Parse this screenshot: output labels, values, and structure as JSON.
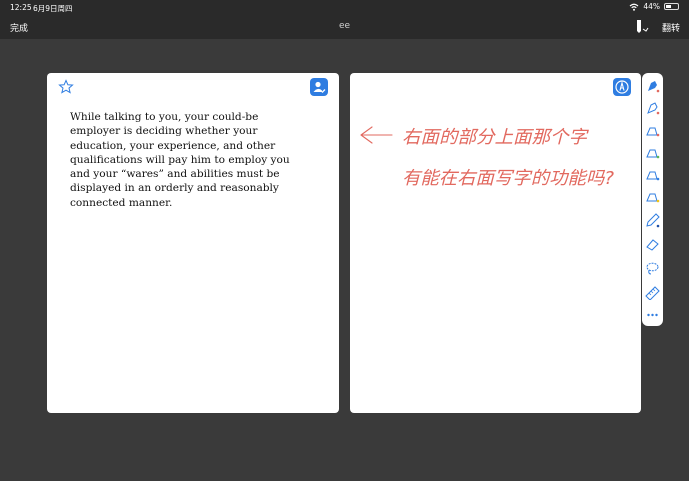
{
  "status_bar": {
    "time": "12:25",
    "date": "6月9日周四",
    "battery_percent": "44%",
    "battery_level": 0.44
  },
  "nav": {
    "done_label": "完成",
    "title": "ee",
    "flip_label": "翻转"
  },
  "left_page": {
    "text": "While talking to you, your could-be employer is deciding whether your education, your experience, and other qualifications will pay him to employ you and your “wares” and abilities must be displayed in an orderly and reasonably connected manner."
  },
  "right_page": {
    "annotation_lines": [
      "右面的部分上面那个字",
      "有能在右面写字的功能吗?"
    ],
    "annotation_color": "#e2695f"
  },
  "colors": {
    "background": "#3a3a3a",
    "bars": "#2a2a2a",
    "accent": "#2f7de1"
  },
  "tools": [
    "fountain-pen",
    "pen",
    "highlighter",
    "highlighter",
    "highlighter",
    "highlighter",
    "pencil",
    "eraser",
    "lasso",
    "ruler",
    "more"
  ]
}
